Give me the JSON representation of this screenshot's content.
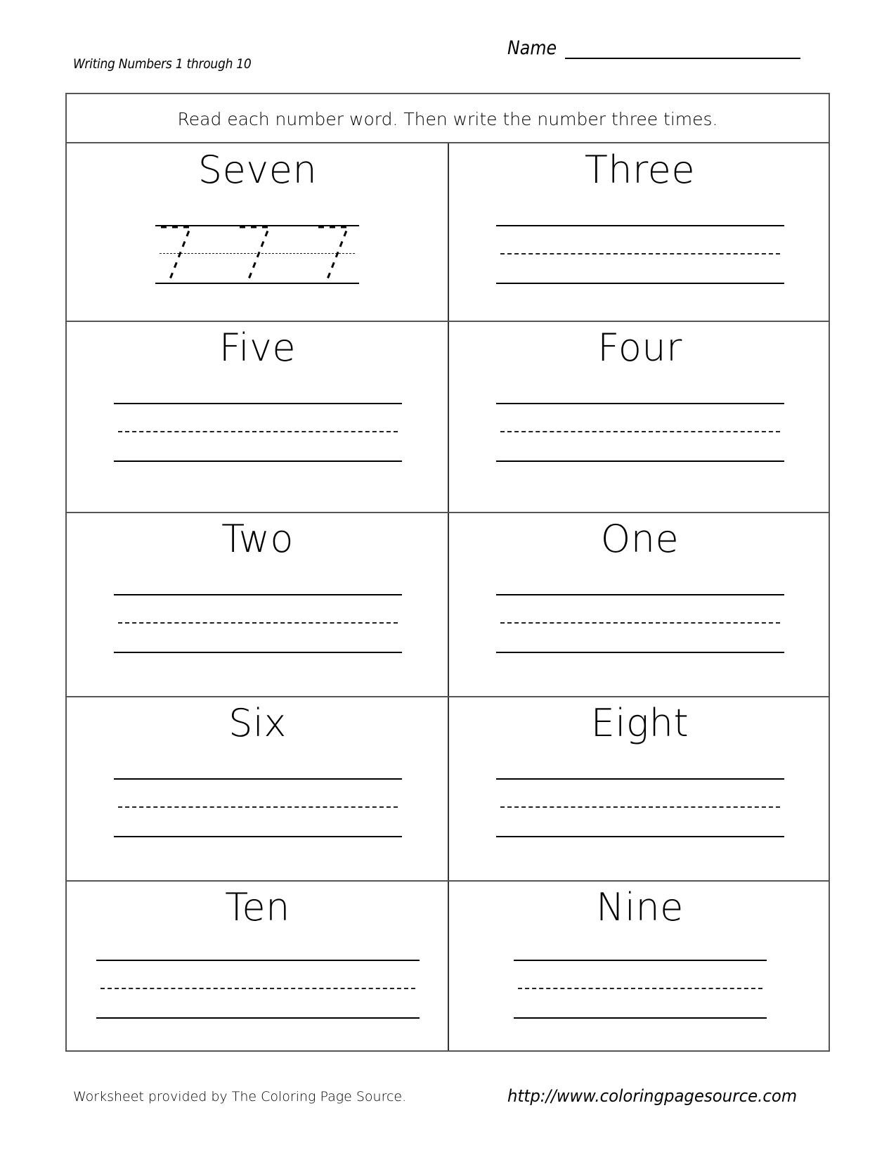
{
  "header": {
    "subtitle": "Writing Numbers 1 through 10",
    "name_label": "Name"
  },
  "instructions": "Read each number word.  Then write the number three times.",
  "cells": [
    {
      "word": "Seven",
      "traced_digit": "7",
      "traced_count": 3
    },
    {
      "word": "Three"
    },
    {
      "word": "Five"
    },
    {
      "word": "Four"
    },
    {
      "word": "Two"
    },
    {
      "word": "One"
    },
    {
      "word": "Six"
    },
    {
      "word": "Eight"
    },
    {
      "word": "Ten"
    },
    {
      "word": "Nine"
    }
  ],
  "footer": {
    "credit": "Worksheet provided by The Coloring Page Source.",
    "url": "http://www.coloringpagesource.com"
  }
}
